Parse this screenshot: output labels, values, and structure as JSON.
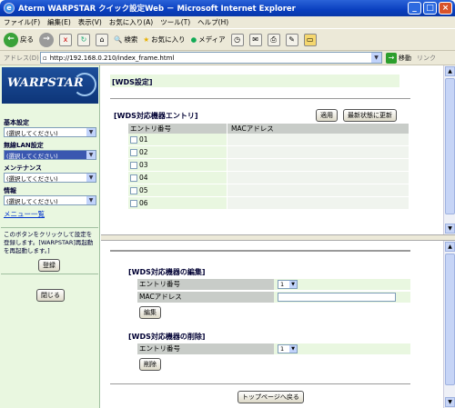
{
  "window": {
    "title": "Aterm WARPSTAR クイック設定Web － Microsoft Internet Explorer"
  },
  "menu": [
    "ファイル(F)",
    "編集(E)",
    "表示(V)",
    "お気に入り(A)",
    "ツール(T)",
    "ヘルプ(H)"
  ],
  "toolbar": {
    "back": "戻る",
    "search": "検索",
    "favorites": "お気に入り",
    "media": "メディア"
  },
  "address": {
    "label": "アドレス(D)",
    "url": "http://192.168.0.210/index_frame.html",
    "go": "移動",
    "links": "リンク"
  },
  "sidebar": {
    "logo": "WARPSTAR",
    "sections": [
      {
        "label": "基本設定",
        "value": "(選択してください)"
      },
      {
        "label": "無線LAN設定",
        "value": "(選択してください)"
      },
      {
        "label": "メンテナンス",
        "value": "(選択してください)"
      },
      {
        "label": "情報",
        "value": "(選択してください)"
      }
    ],
    "menu_list": "メニュー一覧",
    "hint": "このボタンをクリックして設定を登録します。[WARPSTAR]再起動を再起動します。]",
    "register": "登録",
    "close": "閉じる"
  },
  "main": {
    "title": "[WDS設定]",
    "entry": {
      "title": "[WDS対応機器エントリ]",
      "apply": "適用",
      "refresh": "最新状態に更新",
      "col_entry": "エントリ番号",
      "col_mac": "MACアドレス",
      "rows": [
        "01",
        "02",
        "03",
        "04",
        "05",
        "06"
      ]
    },
    "edit": {
      "title": "[WDS対応機器の編集]",
      "entry_label": "エントリ番号",
      "entry_value": "1",
      "mac_label": "MACアドレス",
      "button": "編集"
    },
    "delete": {
      "title": "[WDS対応機器の削除]",
      "entry_label": "エントリ番号",
      "entry_value": "1",
      "button": "削除"
    },
    "top_button": "トップページへ戻る"
  }
}
